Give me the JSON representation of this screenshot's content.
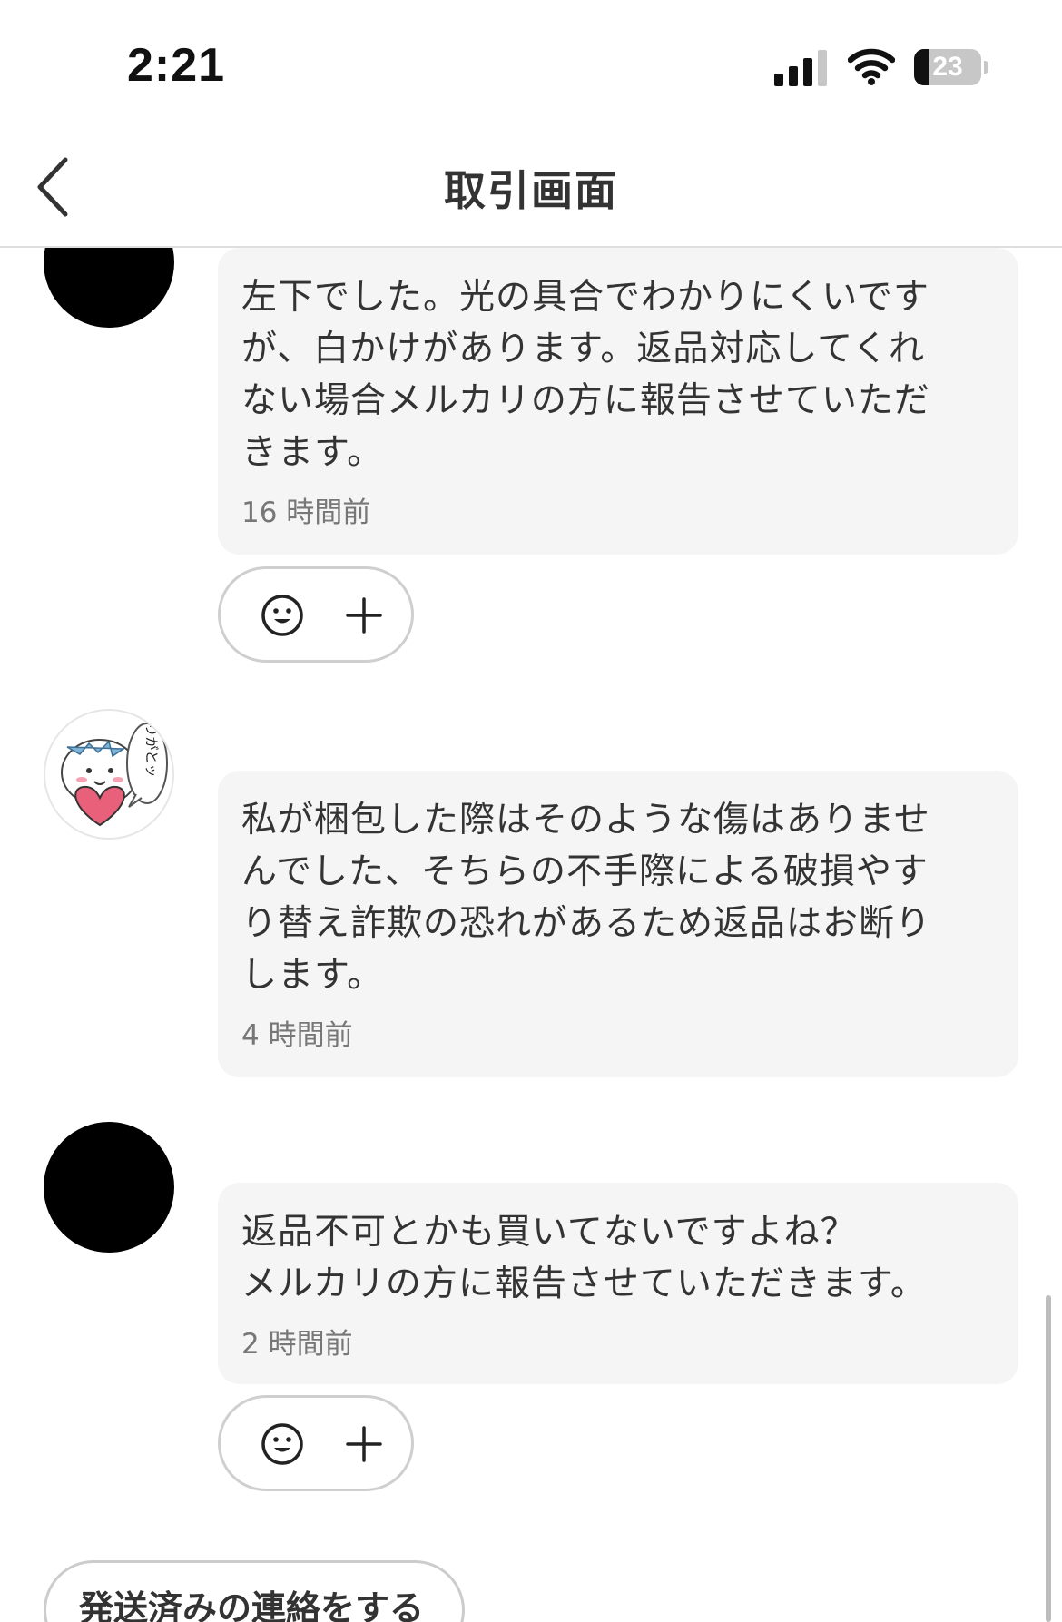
{
  "status_bar": {
    "time": "2:21",
    "battery_level": "23",
    "battery_fraction": 0.23,
    "icons": [
      "signal-icon",
      "wifi-icon",
      "battery-icon"
    ]
  },
  "header": {
    "title": "取引画面",
    "back_icon": "chevron-left-icon"
  },
  "messages": [
    {
      "sender": "buyer",
      "avatar": "black-circle",
      "text": "左下でした。光の具合でわかりにくいですが、白かけがあります。返品対応してくれない場合メルカリの方に報告させていただきます。",
      "lines": [
        "左下でした。光の具合でわかりにくいです",
        "が、白かけがあります。返品対応してくれ",
        "ない場合メルカリの方に報告させていただ",
        "きます。"
      ],
      "time": "16 時間前",
      "reactions": {
        "emoji_icon": "smile-icon",
        "add_icon": "plus-icon"
      }
    },
    {
      "sender": "seller",
      "avatar": "sticker-ありがとッ",
      "avatar_text": "ありがとッ",
      "text": "私が梱包した際はそのような傷はありませんでした、そちらの不手際による破損やすり替え詐欺の恐れがあるため返品はお断りします。",
      "lines": [
        "私が梱包した際はそのような傷はありませ",
        "んでした、そちらの不手際による破損やす",
        "り替え詐欺の恐れがあるため返品はお断り",
        "します。"
      ],
      "time": "4 時間前"
    },
    {
      "sender": "buyer",
      "avatar": "black-circle",
      "text": "返品不可とかも買いてないですよね？\nメルカリの方に報告させていただきます。",
      "lines": [
        "返品不可とかも買いてないですよね？",
        "メルカリの方に報告させていただきます。"
      ],
      "time": "2 時間前",
      "reactions": {
        "emoji_icon": "smile-icon",
        "add_icon": "plus-icon"
      }
    }
  ],
  "actions": {
    "ship_notify_label": "発送済みの連絡をする"
  },
  "colors": {
    "bubble_bg": "#f5f5f5",
    "text": "#333333",
    "time_text": "#777777",
    "divider": "#dedede",
    "pill_border": "#cfcfcf"
  }
}
